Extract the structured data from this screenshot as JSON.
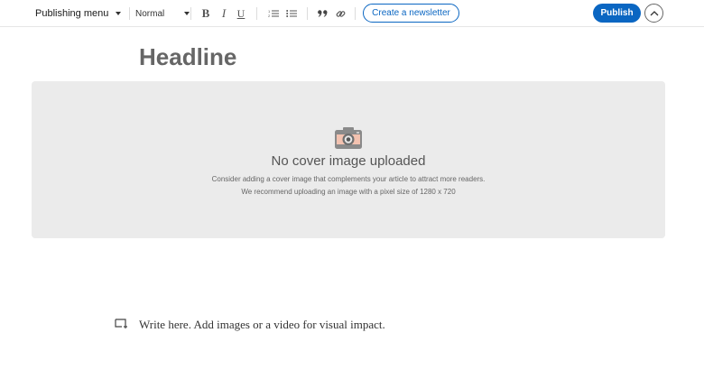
{
  "toolbar": {
    "publishing_menu": "Publishing menu",
    "text_style": "Normal",
    "bold": "B",
    "italic": "I",
    "underline": "U",
    "numbered_list_icon": "numbered-list-icon",
    "bulleted_list_icon": "bulleted-list-icon",
    "quote_icon": "quote-icon",
    "link_icon": "link-icon",
    "create_newsletter": "Create a newsletter",
    "publish": "Publish",
    "collapse_icon": "chevron-up-icon"
  },
  "editor": {
    "headline_placeholder": "Headline",
    "cover": {
      "icon": "camera-icon",
      "title": "No cover image uploaded",
      "line1": "Consider adding a cover image that complements your article to attract more readers.",
      "line2": "We recommend uploading an image with a pixel size of 1280 x 720"
    },
    "body_placeholder": "Write here. Add images or a video for visual impact.",
    "body_icon": "media-insert-icon"
  },
  "colors": {
    "accent": "#0a66c2",
    "cover_bg": "#ebebeb",
    "headline": "#666666"
  }
}
